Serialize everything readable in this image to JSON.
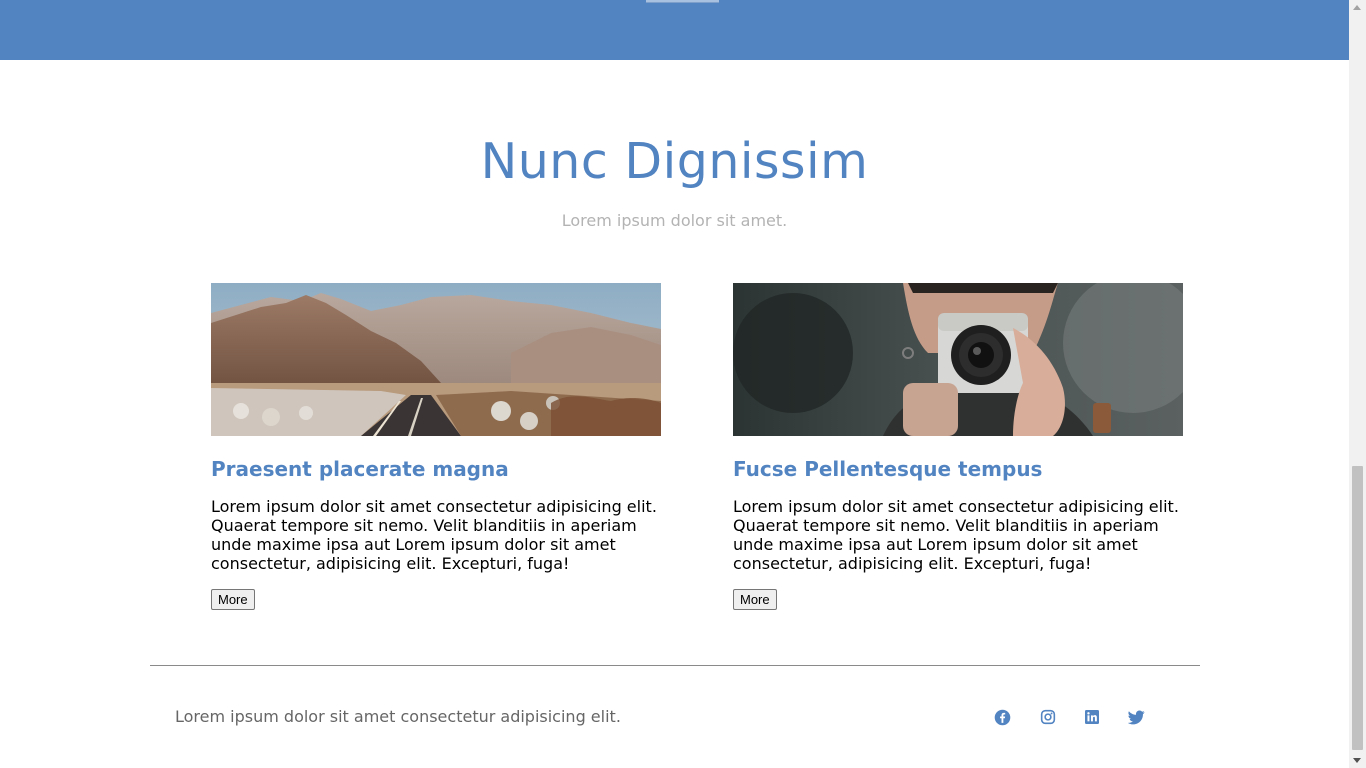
{
  "section": {
    "title": "Nunc Dignissim",
    "subtitle": "Lorem ipsum dolor sit amet."
  },
  "cards": [
    {
      "image": "desert-mountain-road-photo",
      "title": "Praesent placerate magna",
      "body": "Lorem ipsum dolor sit amet consectetur adipisicing elit. Quaerat tempore sit nemo. Velit blanditiis in aperiam unde maxime ipsa aut Lorem ipsum dolor sit amet consectetur, adipisicing elit. Excepturi, fuga!",
      "button": "More"
    },
    {
      "image": "photographer-with-camera-photo",
      "title": "Fucse Pellentesque tempus",
      "body": "Lorem ipsum dolor sit amet consectetur adipisicing elit. Quaerat tempore sit nemo. Velit blanditiis in aperiam unde maxime ipsa aut Lorem ipsum dolor sit amet consectetur, adipisicing elit. Excepturi, fuga!",
      "button": "More"
    }
  ],
  "footer": {
    "text": "Lorem ipsum dolor sit amet consectetur adipisicing elit.",
    "social": [
      "facebook-icon",
      "instagram-icon",
      "linkedin-icon",
      "twitter-icon"
    ]
  },
  "colors": {
    "accent": "#5284c2",
    "subtitle": "#b3b3b3",
    "footer_text": "#666666"
  }
}
